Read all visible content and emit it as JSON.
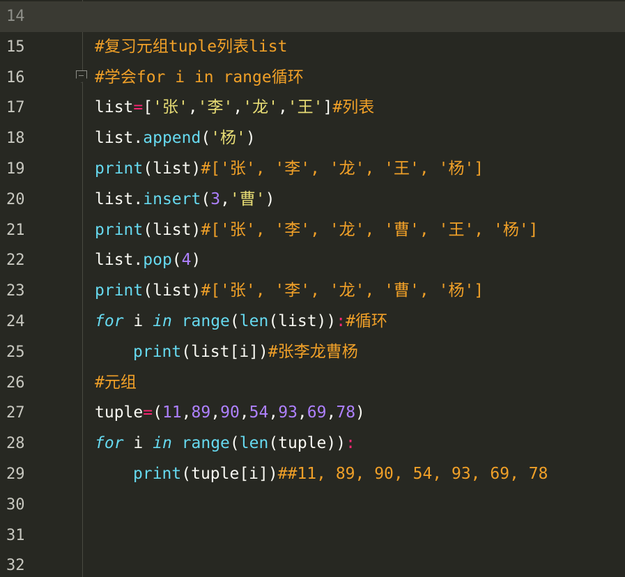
{
  "editor": {
    "lines": [
      {
        "number": "14"
      },
      {
        "number": "15",
        "tokens": [
          [
            "c-cmt",
            "#复习元组tuple列表list"
          ]
        ]
      },
      {
        "number": "16",
        "tokens": [
          [
            "c-cmt",
            "#学会for i in range循环"
          ]
        ]
      },
      {
        "number": "17",
        "tokens": [
          [
            "c-txt",
            "list"
          ],
          [
            "c-op",
            "="
          ],
          [
            "c-txt",
            "["
          ],
          [
            "c-str",
            "'张'"
          ],
          [
            "c-txt",
            ","
          ],
          [
            "c-str",
            "'李'"
          ],
          [
            "c-txt",
            ","
          ],
          [
            "c-str",
            "'龙'"
          ],
          [
            "c-txt",
            ","
          ],
          [
            "c-str",
            "'王'"
          ],
          [
            "c-txt",
            "]"
          ],
          [
            "c-cmt",
            "#列表"
          ]
        ]
      },
      {
        "number": "18",
        "tokens": [
          [
            "c-txt",
            "list."
          ],
          [
            "c-fn",
            "append"
          ],
          [
            "c-txt",
            "("
          ],
          [
            "c-str",
            "'杨'"
          ],
          [
            "c-txt",
            ")"
          ]
        ]
      },
      {
        "number": "19",
        "tokens": [
          [
            "c-fn",
            "print"
          ],
          [
            "c-txt",
            "(list)"
          ],
          [
            "c-cmt",
            "#['张', '李', '龙', '王', '杨']"
          ]
        ]
      },
      {
        "number": "20",
        "tokens": [
          [
            "c-txt",
            "list."
          ],
          [
            "c-fn",
            "insert"
          ],
          [
            "c-txt",
            "("
          ],
          [
            "c-num",
            "3"
          ],
          [
            "c-txt",
            ","
          ],
          [
            "c-str",
            "'曹'"
          ],
          [
            "c-txt",
            ")"
          ]
        ]
      },
      {
        "number": "21",
        "tokens": [
          [
            "c-fn",
            "print"
          ],
          [
            "c-txt",
            "(list)"
          ],
          [
            "c-cmt",
            "#['张', '李', '龙', '曹', '王', '杨']"
          ]
        ]
      },
      {
        "number": "22",
        "tokens": [
          [
            "c-txt",
            "list."
          ],
          [
            "c-fn",
            "pop"
          ],
          [
            "c-txt",
            "("
          ],
          [
            "c-num",
            "4"
          ],
          [
            "c-txt",
            ")"
          ]
        ]
      },
      {
        "number": "23",
        "tokens": [
          [
            "c-fn",
            "print"
          ],
          [
            "c-txt",
            "(list)"
          ],
          [
            "c-cmt",
            "#['张', '李', '龙', '曹', '杨']"
          ]
        ]
      },
      {
        "number": "24",
        "tokens": [
          [
            "c-kw",
            "for"
          ],
          [
            "c-txt",
            " i "
          ],
          [
            "c-kw",
            "in"
          ],
          [
            "c-txt",
            " "
          ],
          [
            "c-fn",
            "range"
          ],
          [
            "c-txt",
            "("
          ],
          [
            "c-fn",
            "len"
          ],
          [
            "c-txt",
            "(list))"
          ],
          [
            "c-op",
            ":"
          ],
          [
            "c-cmt",
            "#循环"
          ]
        ]
      },
      {
        "number": "25",
        "indent": true,
        "tokens": [
          [
            "c-fn",
            "print"
          ],
          [
            "c-txt",
            "(list[i])"
          ],
          [
            "c-cmt",
            "#张李龙曹杨"
          ]
        ]
      },
      {
        "number": "26",
        "tokens": [
          [
            "c-cmt",
            "#元组"
          ]
        ]
      },
      {
        "number": "27",
        "tokens": [
          [
            "c-txt",
            "tuple"
          ],
          [
            "c-op",
            "="
          ],
          [
            "c-txt",
            "("
          ],
          [
            "c-num",
            "11"
          ],
          [
            "c-txt",
            ","
          ],
          [
            "c-num",
            "89"
          ],
          [
            "c-txt",
            ","
          ],
          [
            "c-num",
            "90"
          ],
          [
            "c-txt",
            ","
          ],
          [
            "c-num",
            "54"
          ],
          [
            "c-txt",
            ","
          ],
          [
            "c-num",
            "93"
          ],
          [
            "c-txt",
            ","
          ],
          [
            "c-num",
            "69"
          ],
          [
            "c-txt",
            ","
          ],
          [
            "c-num",
            "78"
          ],
          [
            "c-txt",
            ")"
          ]
        ]
      },
      {
        "number": "28",
        "tokens": [
          [
            "c-kw",
            "for"
          ],
          [
            "c-txt",
            " i "
          ],
          [
            "c-kw",
            "in"
          ],
          [
            "c-txt",
            " "
          ],
          [
            "c-fn",
            "range"
          ],
          [
            "c-txt",
            "("
          ],
          [
            "c-fn",
            "len"
          ],
          [
            "c-txt",
            "(tuple))"
          ],
          [
            "c-op",
            ":"
          ]
        ]
      },
      {
        "number": "29",
        "indent": true,
        "tokens": [
          [
            "c-fn",
            "print"
          ],
          [
            "c-txt",
            "(tuple[i])"
          ],
          [
            "c-cmt",
            "##11, 89, 90, 54, 93, 69, 78"
          ]
        ]
      },
      {
        "number": "30"
      },
      {
        "number": "31"
      },
      {
        "number": "32"
      }
    ],
    "current_line": "14",
    "fold_marker_line": "16",
    "fold_icon": "fold-collapse-icon",
    "colors": {
      "background": "#272822",
      "comment": "#f0a028",
      "function": "#66d9ef",
      "string": "#e6db74",
      "number": "#ae81ff",
      "operator": "#f92672",
      "text": "#f8f8f2"
    }
  }
}
